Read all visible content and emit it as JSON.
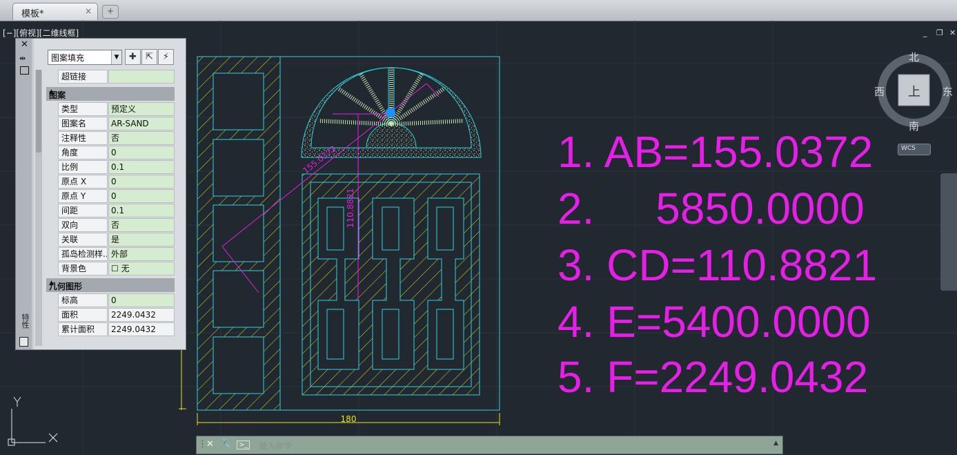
{
  "tab": {
    "title": "模板*",
    "close": "×",
    "add": "+"
  },
  "view_label": "[−][俯视][二维线框]",
  "window_controls": [
    "_",
    "❐",
    "✕"
  ],
  "palette": {
    "close": "✕",
    "object_type": "图案填充",
    "side_label": "特性",
    "hyperlink": {
      "key": "超链接",
      "value": ""
    },
    "sections": [
      {
        "title": "图案",
        "collapse": "▲",
        "rows": [
          {
            "key": "类型",
            "value": "预定义"
          },
          {
            "key": "图案名",
            "value": "AR-SAND"
          },
          {
            "key": "注释性",
            "value": "否"
          },
          {
            "key": "角度",
            "value": "0"
          },
          {
            "key": "比例",
            "value": "0.1"
          },
          {
            "key": "原点 X",
            "value": "0"
          },
          {
            "key": "原点 Y",
            "value": "0"
          },
          {
            "key": "间距",
            "value": "0.1"
          },
          {
            "key": "双向",
            "value": "否"
          },
          {
            "key": "关联",
            "value": "是"
          },
          {
            "key": "孤岛检测样...",
            "value": "外部"
          },
          {
            "key": "背景色",
            "value": "☐ 无"
          }
        ]
      },
      {
        "title": "几何图形",
        "collapse": "▲",
        "rows": [
          {
            "key": "标高",
            "value": "0"
          },
          {
            "key": "面积",
            "value": "2249.0432"
          },
          {
            "key": "累计面积",
            "value": "2249.0432"
          }
        ]
      }
    ]
  },
  "drawing": {
    "dim_bottom": "180",
    "dim_diag": "155.0372",
    "dim_vert": "110.8821"
  },
  "answers": [
    "1. AB=155.0372",
    "2.     5850.0000",
    "3. CD=110.8821",
    "4. E=5400.0000",
    "5. F=2249.0432"
  ],
  "compass": {
    "north": "北",
    "south": "南",
    "east": "东",
    "west": "西",
    "top": "上",
    "wcs": "WCS"
  },
  "command": {
    "placeholder": "键入命令",
    "prompt_icon": ">_"
  },
  "ucs": {
    "x": "X",
    "y": "Y"
  },
  "colors": {
    "magenta": "#e61fe6",
    "cyan": "#2ad4e0",
    "yellow": "#e6e61a",
    "background": "#212830"
  }
}
